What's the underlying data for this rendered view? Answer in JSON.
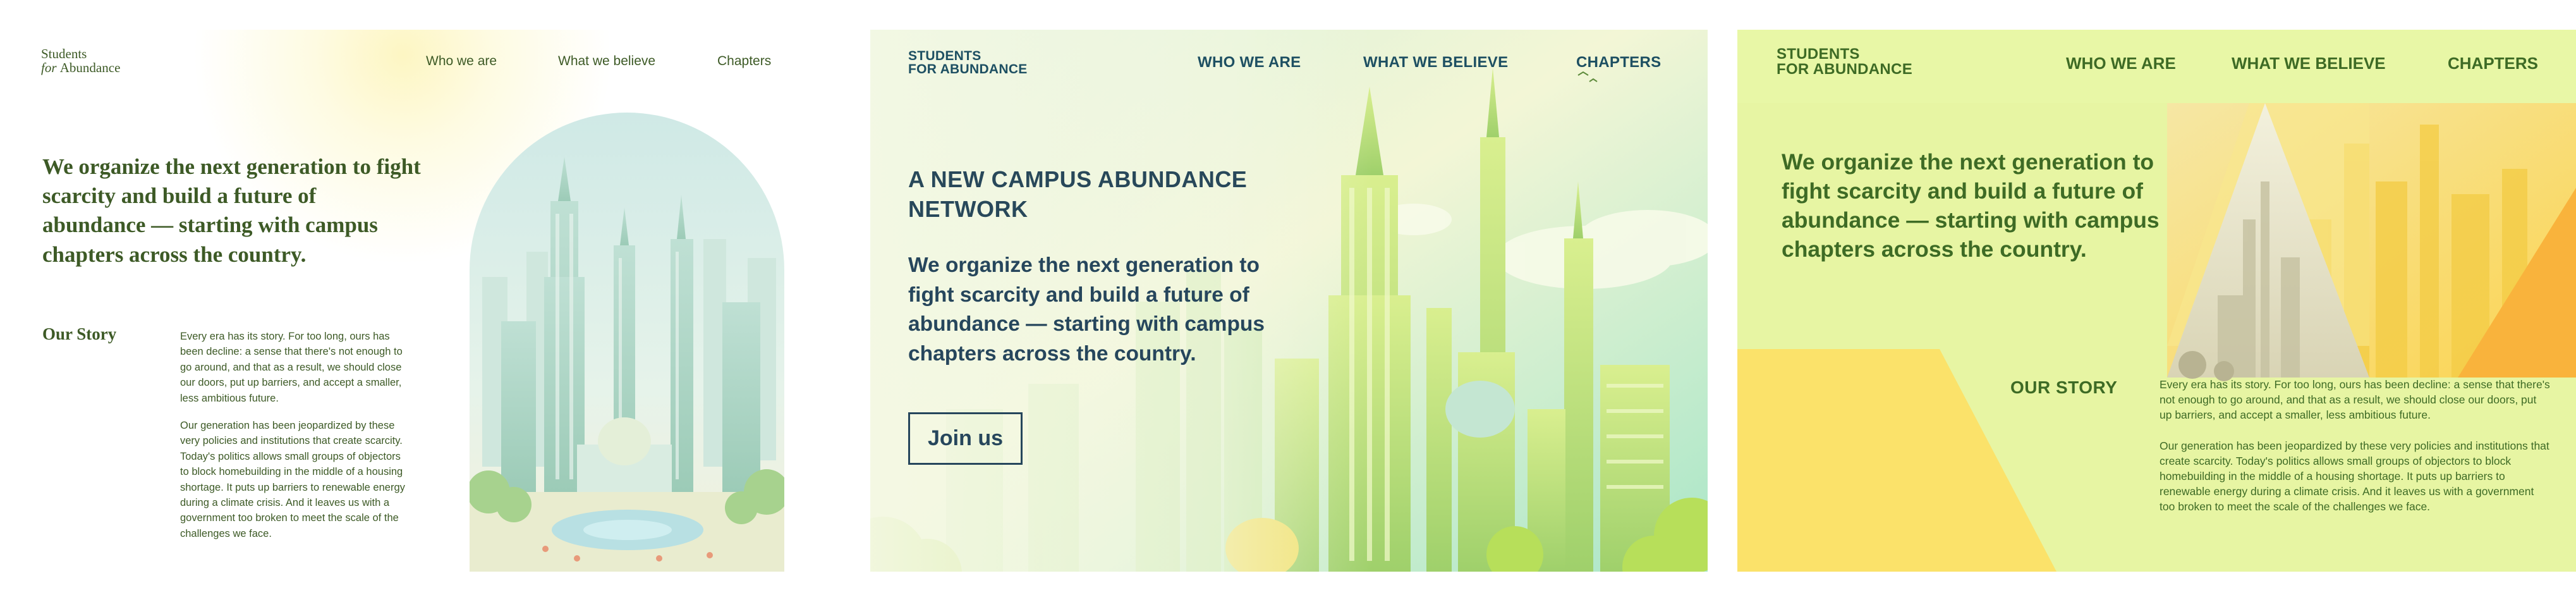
{
  "variant_minimal": {
    "logo": {
      "line1": "Students",
      "line2_for": "for",
      "line2_rest": "Abundance"
    },
    "nav": [
      "Who we are",
      "What we believe",
      "Chapters"
    ],
    "headline": "We organize the next generation to fight scarcity and build a future of abundance — starting with campus chapters across the country.",
    "story_title": "Our Story",
    "story_paragraphs": [
      "Every era has its story. For too long, ours has been decline: a sense that there's not enough to go around, and that as a result, we should close our doors, put up barriers, and accept a smaller, less ambitious future.",
      "Our generation has been jeopardized by these very policies and institutions that create scarcity. Today's politics allows small groups of objectors to block homebuilding in the middle of a housing shortage. It puts up barriers to renewable energy during a climate crisis. And it leaves us with a government too broken to meet the scale of the challenges we face."
    ],
    "colors": {
      "text": "#3d5a26",
      "glow": "#fdf6c3"
    },
    "image": "futuristic-city-illustration"
  },
  "variant_illustrated": {
    "logo": {
      "line1": "STUDENTS",
      "line2": "FOR ABUNDANCE"
    },
    "nav": [
      "WHO WE ARE",
      "WHAT WE BELIEVE",
      "CHAPTERS"
    ],
    "eyebrow": "A NEW CAMPUS ABUNDANCE NETWORK",
    "headline": "We organize the next generation to fight scarcity and build a future of abundance — starting with campus chapters across the country.",
    "cta": "Join us",
    "colors": {
      "text": "#26465c",
      "sky": "#bdeccc",
      "towers": "#cfe98a"
    },
    "image": "futuristic-city-illustration"
  },
  "variant_bold": {
    "logo": {
      "line1": "STUDENTS",
      "line2": "FOR ABUNDANCE"
    },
    "nav": [
      "WHO WE ARE",
      "WHAT WE BELIEVE",
      "CHAPTERS"
    ],
    "headline": "We organize the next generation to fight scarcity and build a future of abundance — starting with campus chapters across the country.",
    "story_title": "OUR STORY",
    "story_paragraphs": [
      "Every era has its story. For too long, ours has been decline: a sense that there's not enough to go around, and that as a result, we should close our doors, put up barriers, and accept a smaller, less ambitious future.",
      "Our generation has been jeopardized by these very policies and institutions that create scarcity. Today's politics allows small groups of objectors to block homebuilding in the middle of a housing shortage. It puts up barriers to renewable energy during a climate crisis. And it leaves us with a government too broken to meet the scale of the challenges we face."
    ],
    "colors": {
      "background": "#e7f5a3",
      "text": "#3e6b25",
      "accent_yellow": "#fbe26a",
      "accent_orange": "#f9b33c"
    },
    "image": "futuristic-city-illustration"
  }
}
